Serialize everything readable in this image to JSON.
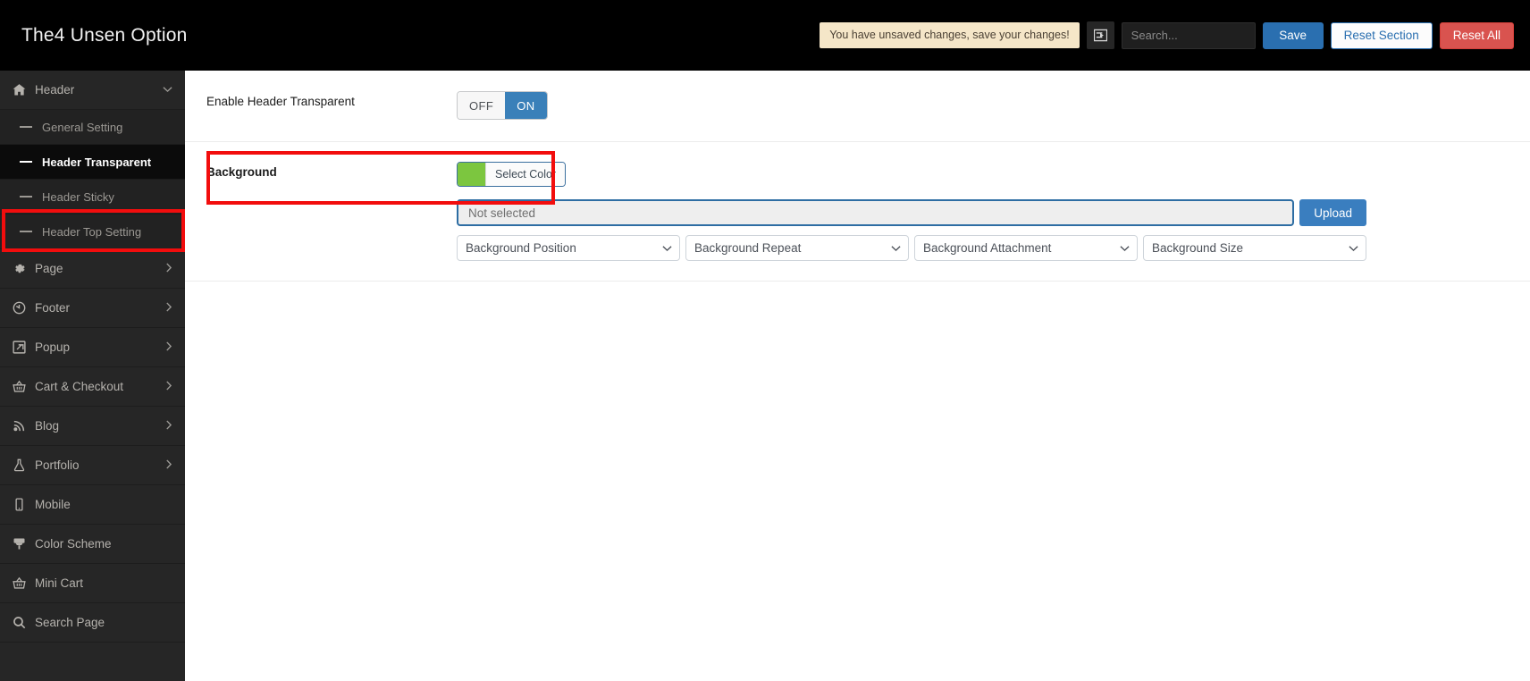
{
  "topbar": {
    "brand": "The4 Unsen Option",
    "unsaved_message": "You have unsaved changes, save your changes!",
    "expand_icon": "panel-collapse-icon",
    "search_placeholder": "Search...",
    "search_value": "",
    "save_label": "Save",
    "reset_section_label": "Reset Section",
    "reset_all_label": "Reset All",
    "colors": {
      "bar_bg": "#000000",
      "unsaved_bg": "#f5e6c8",
      "save_bg": "#2a6fb0",
      "reset_all_bg": "#d9534f"
    }
  },
  "sidebar": {
    "items": [
      {
        "label": "Header",
        "icon": "home-icon",
        "type": "parent",
        "expanded": true,
        "chevron": "chevron-down-icon"
      },
      {
        "label": "General Setting",
        "icon": "dash-icon",
        "type": "sub",
        "active": false
      },
      {
        "label": "Header Transparent",
        "icon": "dash-icon",
        "type": "sub",
        "active": true
      },
      {
        "label": "Header Sticky",
        "icon": "dash-icon",
        "type": "sub",
        "active": false
      },
      {
        "label": "Header Top Setting",
        "icon": "dash-icon",
        "type": "sub",
        "active": false
      },
      {
        "label": "Page",
        "icon": "gear-icon",
        "type": "parent",
        "expanded": false,
        "chevron": "chevron-right-icon"
      },
      {
        "label": "Footer",
        "icon": "clock-reverse-icon",
        "type": "parent",
        "expanded": false,
        "chevron": "chevron-right-icon"
      },
      {
        "label": "Popup",
        "icon": "external-link-icon",
        "type": "parent",
        "expanded": false,
        "chevron": "chevron-right-icon"
      },
      {
        "label": "Cart & Checkout",
        "icon": "basket-icon",
        "type": "parent",
        "expanded": false,
        "chevron": "chevron-right-icon"
      },
      {
        "label": "Blog",
        "icon": "rss-icon",
        "type": "parent",
        "expanded": false,
        "chevron": "chevron-right-icon"
      },
      {
        "label": "Portfolio",
        "icon": "flask-icon",
        "type": "parent",
        "expanded": false,
        "chevron": "chevron-right-icon"
      },
      {
        "label": "Mobile",
        "icon": "mobile-icon",
        "type": "parent",
        "expanded": false,
        "chevron": ""
      },
      {
        "label": "Color Scheme",
        "icon": "paint-brush-icon",
        "type": "parent",
        "expanded": false,
        "chevron": ""
      },
      {
        "label": "Mini Cart",
        "icon": "basket-icon",
        "type": "parent",
        "expanded": false,
        "chevron": ""
      },
      {
        "label": "Search Page",
        "icon": "search-icon",
        "type": "parent",
        "expanded": false,
        "chevron": ""
      }
    ]
  },
  "main": {
    "enable_header_transparent": {
      "label": "Enable Header Transparent",
      "off_label": "OFF",
      "on_label": "ON",
      "state": "ON"
    },
    "background": {
      "label": "Background",
      "select_color_label": "Select Color",
      "swatch_color": "#7cc63f",
      "media_placeholder": "Not selected",
      "media_value": "",
      "upload_label": "Upload",
      "selects": [
        {
          "name": "background-position",
          "placeholder": "Background Position"
        },
        {
          "name": "background-repeat",
          "placeholder": "Background Repeat"
        },
        {
          "name": "background-attachment",
          "placeholder": "Background Attachment"
        },
        {
          "name": "background-size",
          "placeholder": "Background Size"
        }
      ]
    }
  },
  "annotations": {
    "highlight_color": "#f20d0d",
    "boxes": [
      {
        "name": "sidebar-header-transparent-highlight"
      },
      {
        "name": "enable-header-transparent-highlight"
      }
    ]
  }
}
